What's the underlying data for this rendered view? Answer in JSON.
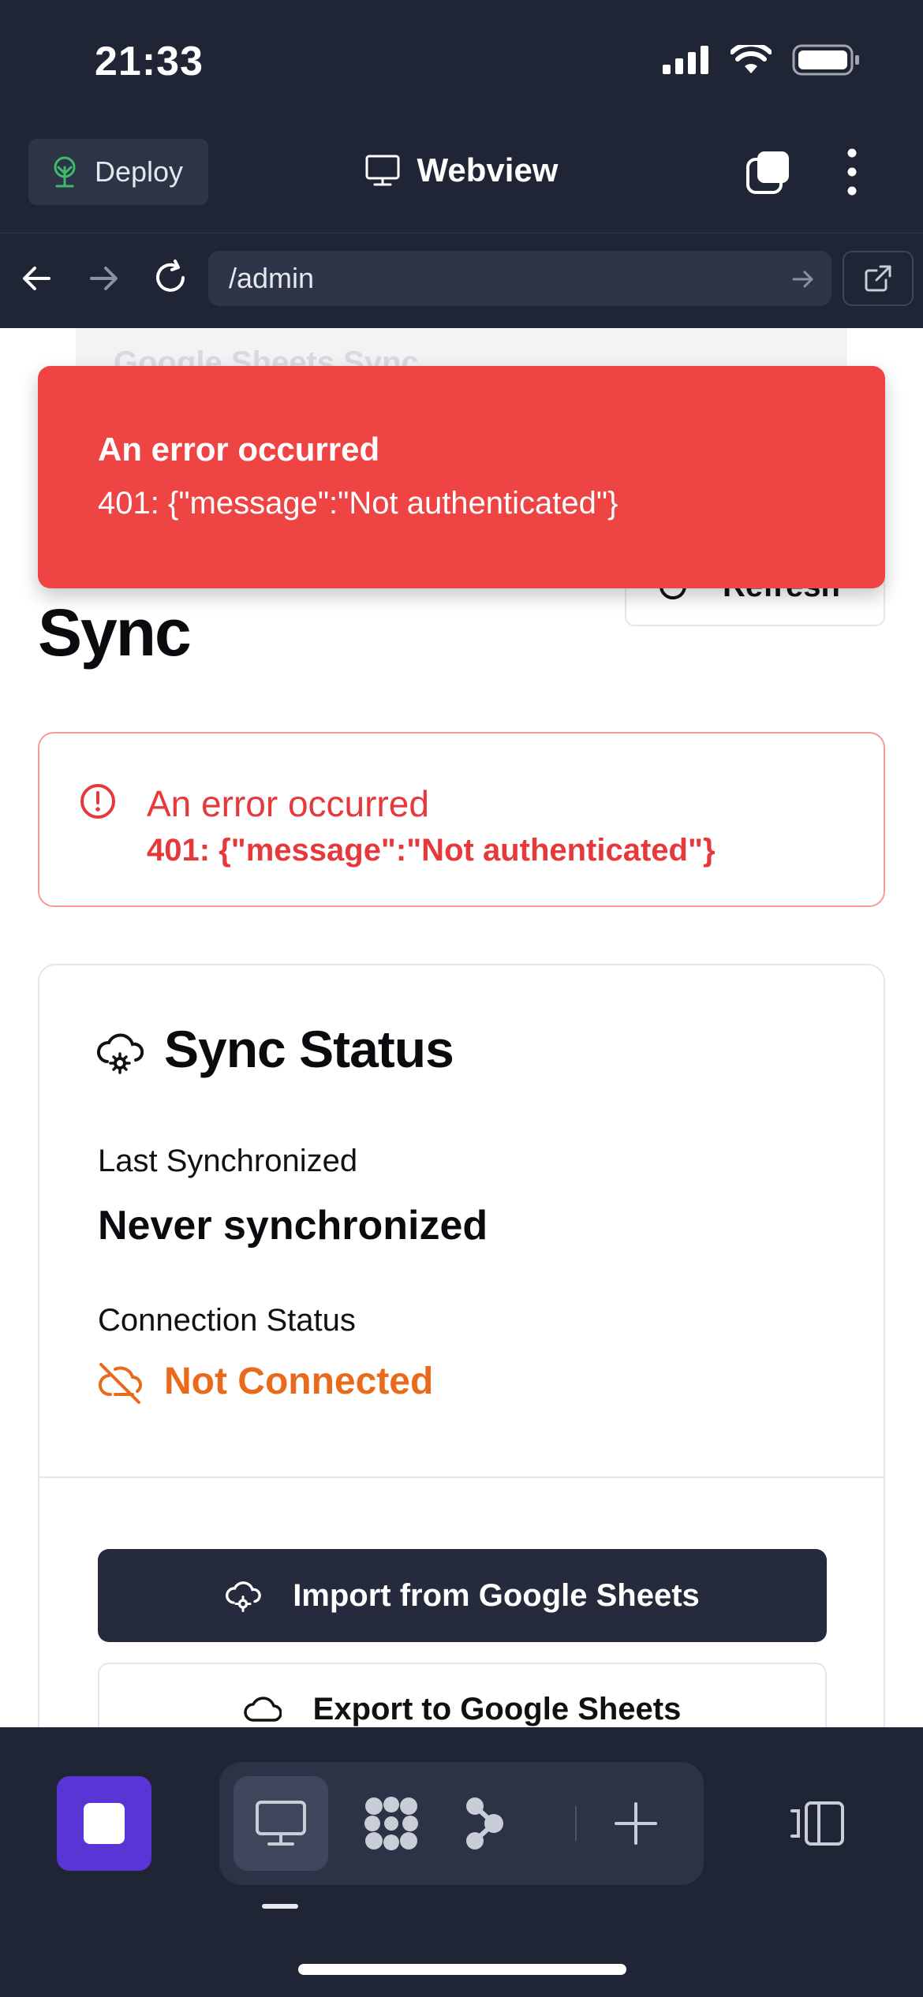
{
  "status_bar": {
    "time": "21:33"
  },
  "app_bar": {
    "deploy_label": "Deploy",
    "title": "Webview"
  },
  "url_bar": {
    "url": "/admin"
  },
  "page": {
    "ghost_header": "Google Sheets Sync",
    "refresh_label": "Refresh",
    "title": "Sync",
    "alert": {
      "title": "An error occurred",
      "message": "401: {\"message\":\"Not authenticated\"}"
    },
    "sync_card": {
      "heading": "Sync Status",
      "last_sync_label": "Last Synchronized",
      "last_sync_value": "Never synchronized",
      "connection_label": "Connection Status",
      "connection_value": "Not Connected",
      "import_label": "Import from Google Sheets",
      "export_label": "Export to Google Sheets"
    }
  },
  "toast": {
    "title": "An error occurred",
    "message": "401: {\"message\":\"Not authenticated\"}"
  },
  "colors": {
    "chrome_bg": "#1f2535",
    "error_red": "#ef4444",
    "warning_orange": "#ea6a1c",
    "stop_purple": "#5a35d6",
    "primary_button": "#252b3c"
  }
}
